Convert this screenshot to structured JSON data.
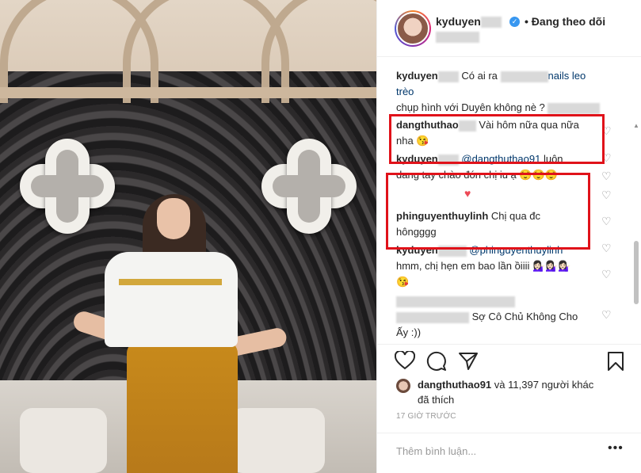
{
  "header": {
    "username": "kyduyen",
    "follow_status": "Đang theo dõi",
    "bullet": "•"
  },
  "caption": {
    "username": "kyduyen",
    "text_a": "Có ai ra",
    "text_b": "nails leo trèo",
    "text_c": "chụp hình với Duyên không nè ?"
  },
  "comments": [
    {
      "username": "dangthuthao",
      "text": "Vài hôm nữa qua nữa",
      "text2": "nha 😘"
    },
    {
      "username": "kyduyen",
      "mention": "@dangthuthao91",
      "text": "luôn",
      "text2": "dang tay chào đón chị iu ạ 😌😌😌"
    },
    {
      "username": "phinguyenthuylinh",
      "text": "Chị qua đc",
      "text2": "hôngggg"
    },
    {
      "username": "kyduyen",
      "mention": "@phinguyenthuylinh",
      "text2": "hmm, chị hẹn em bao lần ồiiii 💁🏻‍♀️💁🏻‍♀️💁🏻‍♀️"
    },
    {
      "text2": "😘"
    },
    {
      "text": "Sợ Cô Chủ Không Cho",
      "text2": "Ấy :))"
    }
  ],
  "likes": {
    "user": "dangthuthao91",
    "text": "và 11,397 người khác",
    "text2": "đã thích"
  },
  "timestamp": "17 GIỜ TRƯỚC",
  "comment_input": {
    "placeholder": "Thêm bình luận..."
  },
  "more_label": "•••",
  "icons": [
    "heart-icon",
    "comment-icon",
    "share-icon",
    "bookmark-icon"
  ],
  "colors": {
    "highlight": "#e0121a",
    "verified": "#3897f0",
    "mention": "#00376b",
    "liked_heart": "#ed4956"
  }
}
